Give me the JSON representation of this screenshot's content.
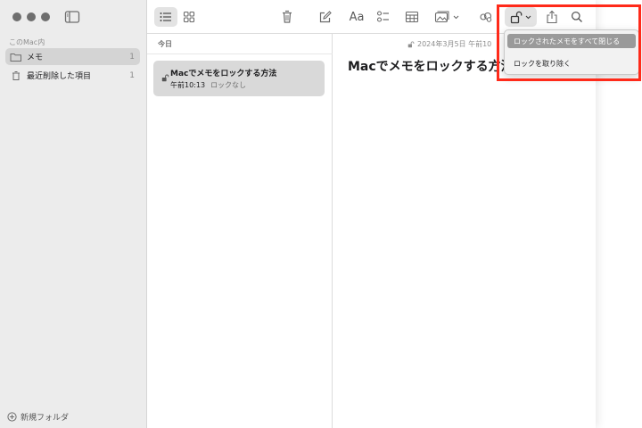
{
  "sidebar": {
    "section_label": "このMac内",
    "items": [
      {
        "label": "メモ",
        "count": "1"
      },
      {
        "label": "最近削除した項目",
        "count": "1"
      }
    ],
    "new_folder_label": "新規フォルダ"
  },
  "toolbar": {
    "format_label": "Aa",
    "icons": [
      "list-view-icon",
      "gallery-view-icon",
      "trash-icon",
      "compose-icon",
      "format-icon",
      "checklist-icon",
      "table-icon",
      "media-icon",
      "collaborate-icon",
      "lock-icon",
      "share-icon",
      "search-icon"
    ]
  },
  "notes_list": {
    "group_header": "今日",
    "notes": [
      {
        "title": "Macでメモをロックする方法",
        "time": "午前10:13",
        "status": "ロックなし"
      }
    ]
  },
  "editor": {
    "date": "2024年3月5日 午前10",
    "title": "Macでメモをロックする方法"
  },
  "lock_menu": {
    "items": [
      "ロックされたメモをすべて閉じる",
      "ロックを取り除く"
    ]
  },
  "colors": {
    "highlight": "#ff2a1a",
    "sidebar_bg": "#ececec",
    "selected_row": "#d4d4d4",
    "menu_highlight": "#9a9a9a"
  }
}
